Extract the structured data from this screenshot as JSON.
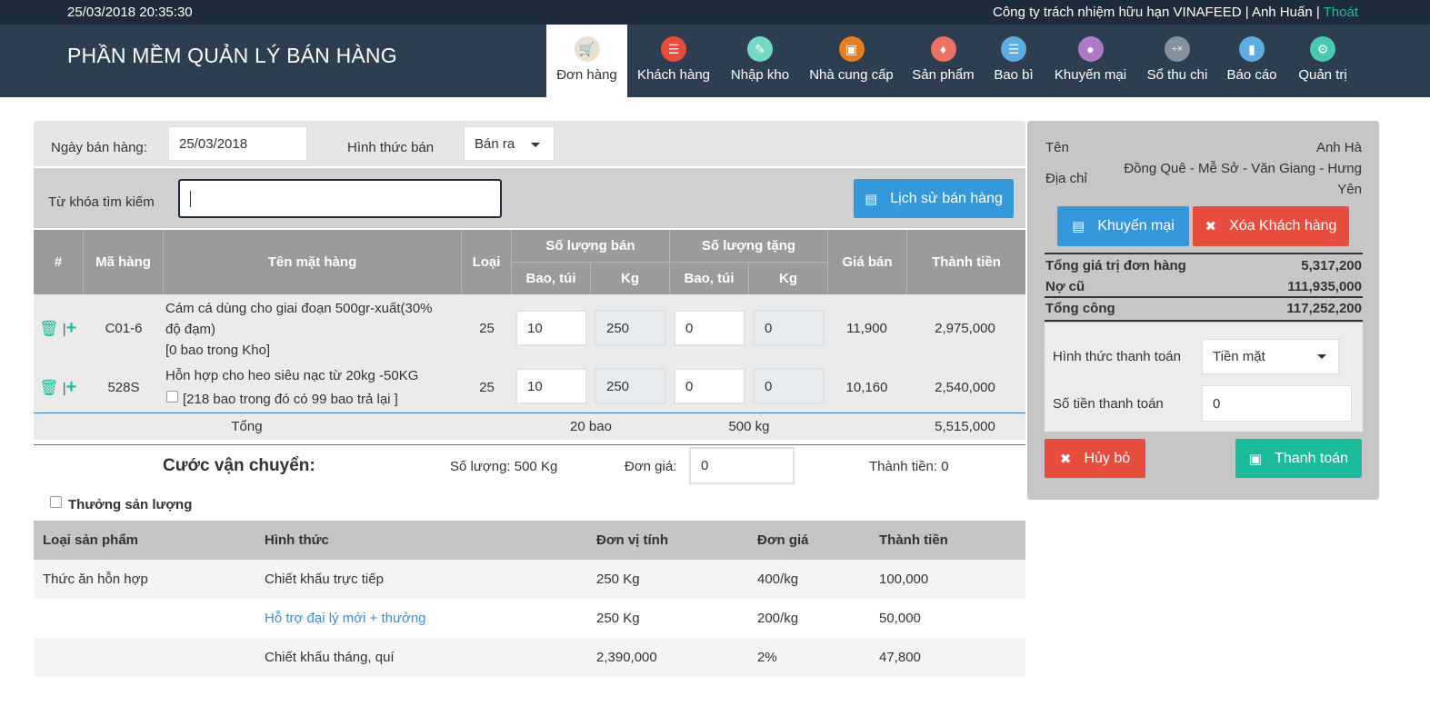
{
  "topbar": {
    "datetime": "25/03/2018 20:35:30",
    "company_user": "Công ty trách nhiệm hữu hạn VINAFEED | Anh Huấn |",
    "logout": "Thoát"
  },
  "header": {
    "title": "PHẦN MỀM QUẢN LÝ BÁN HÀNG",
    "nav": [
      {
        "label": "Đơn hàng",
        "icon": "basket-icon",
        "color": "#e8e0d2"
      },
      {
        "label": "Khách hàng",
        "icon": "contacts-icon",
        "color": "#e74c3c"
      },
      {
        "label": "Nhập kho",
        "icon": "warehouse-icon",
        "color": "#76d7c4"
      },
      {
        "label": "Nhà cung cấp",
        "icon": "briefcase-icon",
        "color": "#e67e22"
      },
      {
        "label": "Sản phẩm",
        "icon": "tag-icon",
        "color": "#ec7063"
      },
      {
        "label": "Bao bì",
        "icon": "layers-icon",
        "color": "#5dade2"
      },
      {
        "label": "Khuyến mại",
        "icon": "coins-icon",
        "color": "#af7ac5"
      },
      {
        "label": "Sổ thu chi",
        "icon": "calculator-icon",
        "color": "#85929e"
      },
      {
        "label": "Báo cáo",
        "icon": "chart-icon",
        "color": "#5dade2"
      },
      {
        "label": "Quản trị",
        "icon": "gear-icon",
        "color": "#48c9b0"
      }
    ]
  },
  "filters": {
    "date_label": "Ngày bán hàng:",
    "date_value": "25/03/2018",
    "sale_type_label": "Hình thức bán",
    "sale_type_value": "Bán ra",
    "search_label": "Từ khóa tìm kiếm",
    "search_value": "",
    "history_button": "Lịch sử bán hàng"
  },
  "table": {
    "headers": {
      "index": "#",
      "code": "Mã hàng",
      "name": "Tên mặt hàng",
      "type": "Loại",
      "qty_sale": "Số lượng bán",
      "qty_gift": "Số lượng tặng",
      "bag": "Bao, túi",
      "kg": "Kg",
      "price": "Giá bán",
      "amount": "Thành tiền"
    },
    "rows": [
      {
        "code": "C01-6",
        "name_line1": "Cám cá dùng cho giai đoạn 500gr-xuất(30%",
        "name_line2": "độ đạm)",
        "name_line3": "[0 bao trong Kho]",
        "type": "25",
        "sale_bag": "10",
        "sale_kg": "250",
        "gift_bag": "0",
        "gift_kg": "0",
        "price": "11,900",
        "amount": "2,975,000"
      },
      {
        "code": "528S",
        "name_line1": "Hỗn hợp cho heo siêu nạc từ 20kg -50KG",
        "name_line2": "[218 bao trong đó có 99 bao trả lại ]",
        "type": "25",
        "sale_bag": "10",
        "sale_kg": "250",
        "gift_bag": "0",
        "gift_kg": "0",
        "price": "10,160",
        "amount": "2,540,000"
      }
    ],
    "total": {
      "label": "Tổng",
      "bags": "20 bao",
      "kg": "500 kg",
      "amount": "5,515,000"
    }
  },
  "shipping": {
    "title": "Cước vận chuyển:",
    "quantity": "Số lượng: 500 Kg",
    "unit_price_label": "Đơn giá:",
    "unit_price_value": "0",
    "amount": "Thành tiền: 0"
  },
  "bonus": {
    "checkbox_label": "Thưởng sản lượng",
    "headers": [
      "Loại sản phẩm",
      "Hình thức",
      "Đơn vị tính",
      "Đơn giá",
      "Thành tiền"
    ],
    "rows": [
      [
        "Thức ăn hỗn hợp",
        "Chiết khấu trực tiếp",
        "250 Kg",
        "400/kg",
        "100,000"
      ],
      [
        "",
        "Hỗ trợ đại lý mới + thưởng",
        "250 Kg",
        "200/kg",
        "50,000"
      ],
      [
        "",
        "Chiết khấu tháng, quí",
        "2,390,000",
        "2%",
        "47,800"
      ]
    ]
  },
  "customer": {
    "name_label": "Tên",
    "name_value": "Anh Hà",
    "address_label": "Địa chỉ",
    "address_line1": "Đồng Quê - Mễ Sở - Văn Giang - Hưng",
    "address_line2": "Yên",
    "promo_button": "Khuyến mại",
    "delete_button": "Xóa Khách hàng",
    "order_total_label": "Tổng giá trị đơn hàng",
    "order_total_value": "5,317,200",
    "old_debt_label": "Nợ cũ",
    "old_debt_value": "111,935,000",
    "grand_total_label": "Tổng công",
    "grand_total_value": "117,252,200",
    "payment_method_label": "Hình thức thanh toán",
    "payment_method_value": "Tiền mặt",
    "payment_amount_label": "Số tiền thanh toán",
    "payment_amount_value": "0",
    "cancel_button": "Hủy bỏ",
    "pay_button": "Thanh toán"
  }
}
